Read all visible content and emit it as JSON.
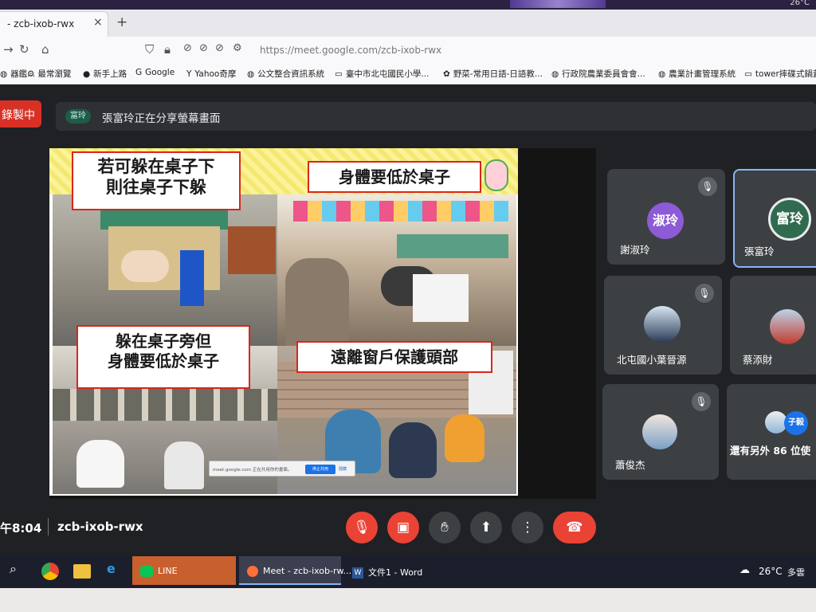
{
  "browser": {
    "clock_text": "26°C",
    "tab_title": "- zcb-ixob-rwx",
    "url": "https://meet.google.com/zcb-ixob-rwx",
    "bookmarks": [
      {
        "icon": "globe-icon",
        "label": "器鑑..."
      },
      {
        "icon": "gear-icon",
        "label": "最常瀏覽"
      },
      {
        "icon": "firefox-icon",
        "label": "新手上路"
      },
      {
        "icon": "google-icon",
        "label": "Google"
      },
      {
        "icon": "yahoo-icon",
        "label": "Yahoo奇摩"
      },
      {
        "icon": "globe-icon",
        "label": "公文整合資訊系統"
      },
      {
        "icon": "page-icon",
        "label": "臺中市北屯國民小學..."
      },
      {
        "icon": "link-icon",
        "label": "野菜-常用日語-日語教..."
      },
      {
        "icon": "globe-icon",
        "label": "行政院農業委員會會..."
      },
      {
        "icon": "globe-icon",
        "label": "農業計畫管理系統"
      },
      {
        "icon": "page-icon",
        "label": "tower摔碟式鍋蓋"
      }
    ]
  },
  "meet": {
    "recording_label": "錄製中",
    "presenter_chip": "富玲",
    "share_text": "張富玲正在分享螢幕畫面",
    "slide": {
      "captions": {
        "under_desk": "若可躲在桌子下\n則往桌子下躲",
        "lower_body": "身體要低於桌子",
        "beside_desk": "躲在桌子旁但\n身體要低於桌子",
        "away_window": "遠離窗戶保護頭部"
      },
      "share_overlay_text": "meet.google.com 正在共用你的畫面。",
      "share_overlay_stop": "停止共用",
      "share_overlay_hide": "隱藏"
    },
    "participants": [
      {
        "name": "謝淑玲",
        "avatar": "淑玲",
        "muted": true
      },
      {
        "name": "張富玲",
        "avatar": "富玲",
        "muted": false
      },
      {
        "name": "北屯國小葉晉源",
        "avatar": "photo",
        "muted": true
      },
      {
        "name": "蔡添財",
        "avatar": "photo",
        "muted": false
      },
      {
        "name": "蕭俊杰",
        "avatar": "photo",
        "muted": true
      },
      {
        "name": "還有另外 86 位使",
        "avatar": "子毅",
        "muted": false
      }
    ],
    "time": "午8:04",
    "meeting_code": "zcb-ixob-rwx"
  },
  "taskbar": {
    "apps": [
      {
        "icon": "line-icon",
        "label": "LINE"
      },
      {
        "icon": "firefox-icon",
        "label": "Meet - zcb-ixob-rw..."
      },
      {
        "icon": "word-icon",
        "label": "文件1 - Word"
      }
    ],
    "weather": "26°C",
    "weather_desc": "多雲"
  },
  "colors": {
    "recording_red": "#d93025",
    "caption_border": "#d8271c",
    "end_call_red": "#ea4335",
    "tile_bg": "#3c4043",
    "active_tile_border": "#8ab4f8"
  }
}
